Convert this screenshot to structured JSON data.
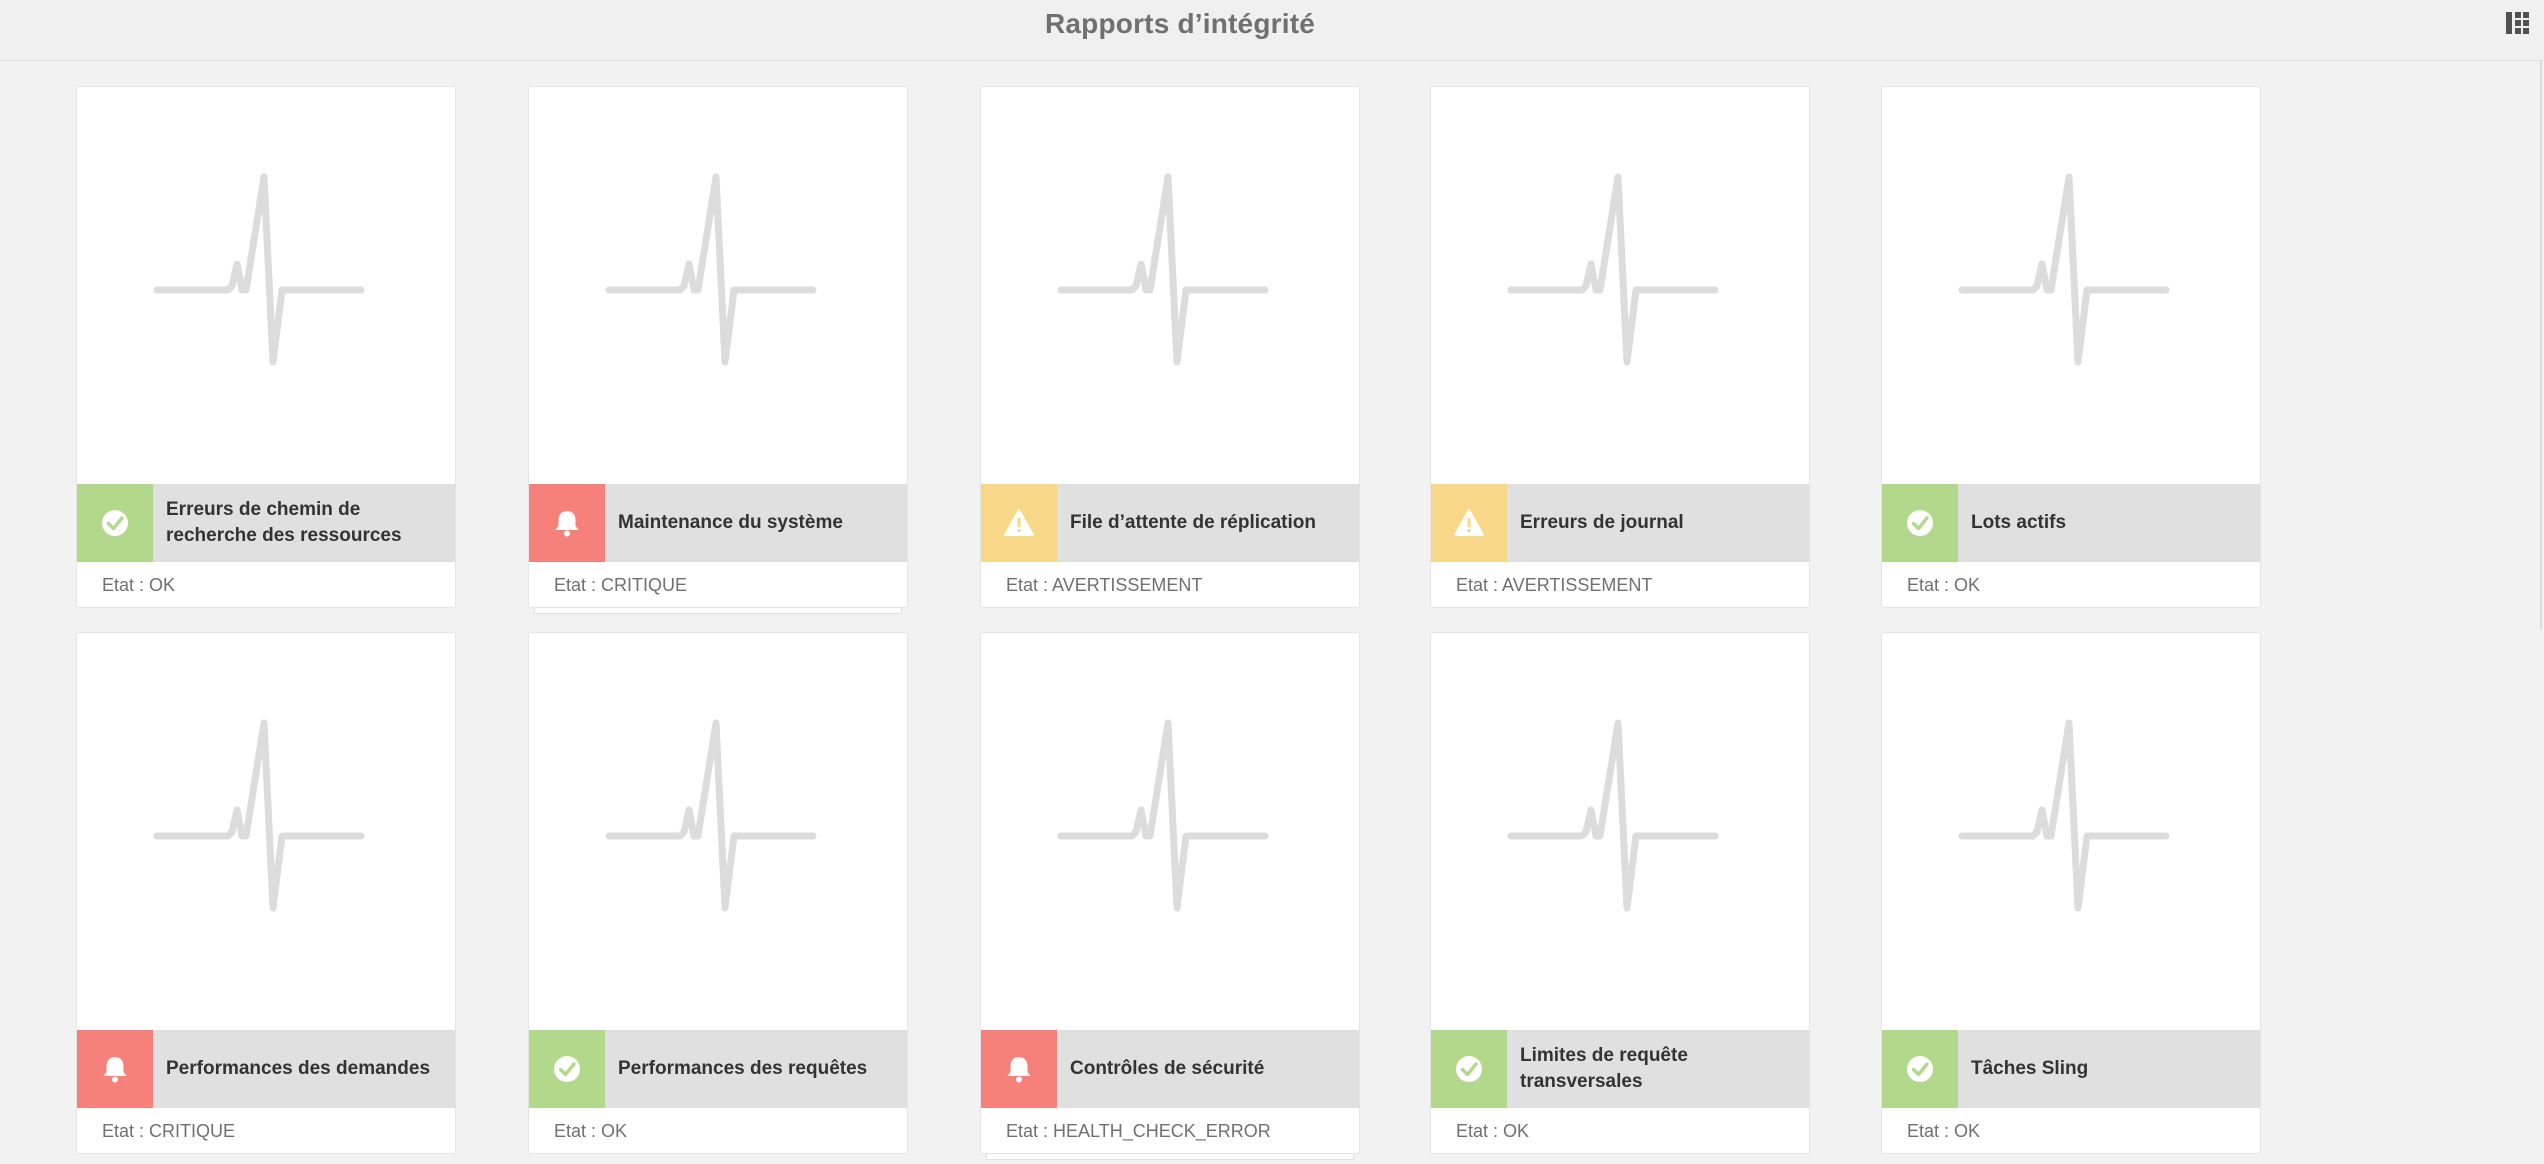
{
  "header": {
    "title": "Rapports d’intégrité",
    "grid_toggle_icon": "grid-view-icon"
  },
  "colors": {
    "ok": "#b2d98b",
    "critical": "#f5817a",
    "warning": "#f8d888",
    "bar": "#e0e0e0",
    "pulse": "#dcdcdc"
  },
  "cards": [
    {
      "label": "Erreurs de chemin de recherche des ressources",
      "status": "Etat : OK",
      "state": "ok",
      "icon": "check-circle-icon"
    },
    {
      "label": "Maintenance du système",
      "status": "Etat : CRITIQUE",
      "state": "critical",
      "icon": "bell-icon"
    },
    {
      "label": "File d’attente de réplication",
      "status": "Etat : AVERTISSEMENT",
      "state": "warning",
      "icon": "warning-triangle-icon"
    },
    {
      "label": "Erreurs de journal",
      "status": "Etat : AVERTISSEMENT",
      "state": "warning",
      "icon": "warning-triangle-icon"
    },
    {
      "label": "Lots actifs",
      "status": "Etat : OK",
      "state": "ok",
      "icon": "check-circle-icon"
    },
    {
      "label": "Performances des demandes",
      "status": "Etat : CRITIQUE",
      "state": "critical",
      "icon": "bell-icon"
    },
    {
      "label": "Performances des requêtes",
      "status": "Etat : OK",
      "state": "ok",
      "icon": "check-circle-icon"
    },
    {
      "label": "Contrôles de sécurité",
      "status": "Etat : HEALTH_CHECK_ERROR",
      "state": "critical",
      "icon": "bell-icon"
    },
    {
      "label": "Limites de requête transversales",
      "status": "Etat : OK",
      "state": "ok",
      "icon": "check-circle-icon"
    },
    {
      "label": "Tâches Sling",
      "status": "Etat : OK",
      "state": "ok",
      "icon": "check-circle-icon"
    }
  ]
}
